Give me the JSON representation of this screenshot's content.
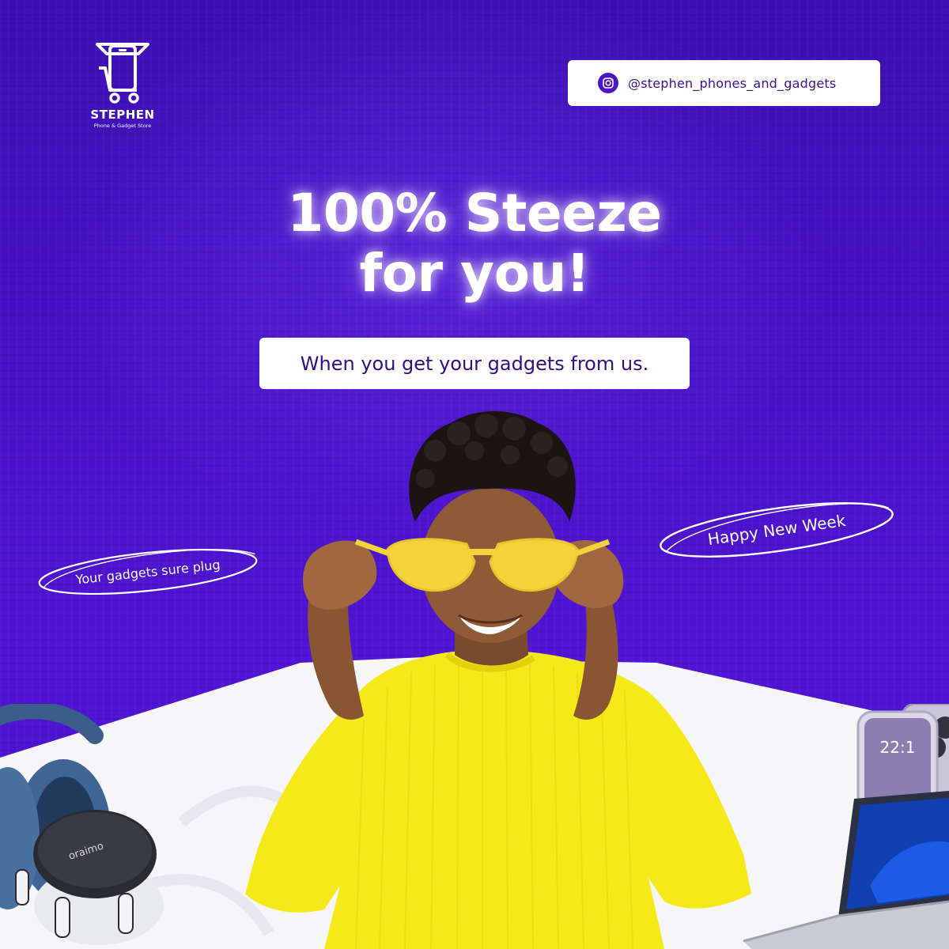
{
  "brand": {
    "name": "STEPHEN",
    "tagline": "Phone & Gadget Store",
    "icon": "phone-in-shopping-cart-icon"
  },
  "social": {
    "handle": "@stephen_phones_and_gadgets",
    "icon": "instagram-icon"
  },
  "headline": {
    "line1": "100% Steeze",
    "line2": "for you!"
  },
  "subheadline": "When you get your gadgets from us.",
  "callouts": {
    "left": "Your gadgets sure plug",
    "right": "Happy New Week"
  },
  "products": {
    "earbuds_brand": "oraimo",
    "phone_time": "22:1"
  },
  "colors": {
    "background": "#4a12c9",
    "accent_text": "#2e0f84",
    "shirt": "#f6e91a",
    "glasses": "#f4d33a"
  }
}
